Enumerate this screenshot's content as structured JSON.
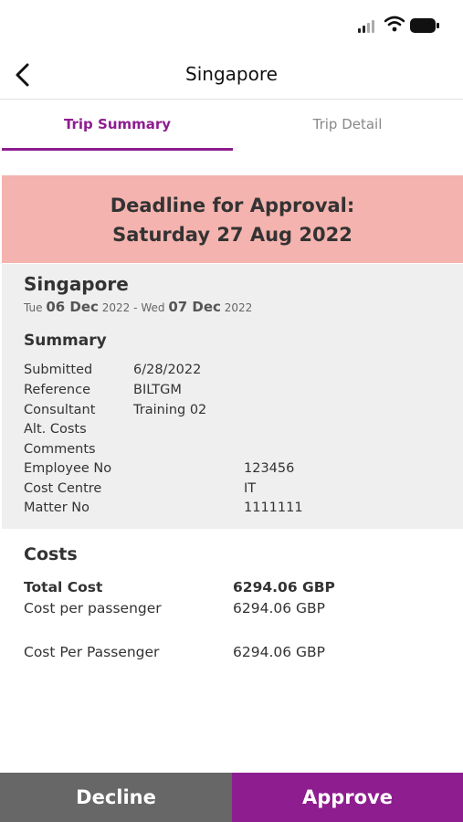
{
  "colors": {
    "accent": "#8e1d8f",
    "deadline_bg": "#f4b3ae",
    "decline_bg": "#676767",
    "info_bg": "#efefef"
  },
  "header": {
    "title": "Singapore",
    "back_icon": "chevron-left-icon"
  },
  "tabs": [
    {
      "label": "Trip Summary",
      "active": true
    },
    {
      "label": "Trip Detail",
      "active": false
    }
  ],
  "deadline": {
    "line1": "Deadline for Approval:",
    "line2": "Saturday 27 Aug 2022"
  },
  "trip": {
    "city": "Singapore",
    "start_dow": "Tue",
    "start_daymonth": "06 Dec",
    "start_year": "2022",
    "separator": "-",
    "end_dow": "Wed",
    "end_daymonth": "07 Dec",
    "end_year": "2022"
  },
  "summary": {
    "title": "Summary",
    "rows": [
      {
        "label": "Submitted",
        "value": "6/28/2022"
      },
      {
        "label": "Reference",
        "value": "BILTGM"
      },
      {
        "label": "Consultant",
        "value": "Training 02"
      },
      {
        "label": "Alt. Costs",
        "value": ""
      },
      {
        "label": "Comments",
        "value": ""
      },
      {
        "label": "Employee No",
        "value": "123456"
      },
      {
        "label": "Cost Centre",
        "value": "IT"
      },
      {
        "label": "Matter No",
        "value": "1111111"
      }
    ]
  },
  "costs": {
    "title": "Costs",
    "total_label": "Total Cost",
    "total_value": "6294.06 GBP",
    "per_passenger_label": "Cost per passenger",
    "per_passenger_value": "6294.06 GBP",
    "per_passenger2_label": "Cost Per Passenger",
    "per_passenger2_value": "6294.06 GBP"
  },
  "actions": {
    "decline": "Decline",
    "approve": "Approve"
  }
}
